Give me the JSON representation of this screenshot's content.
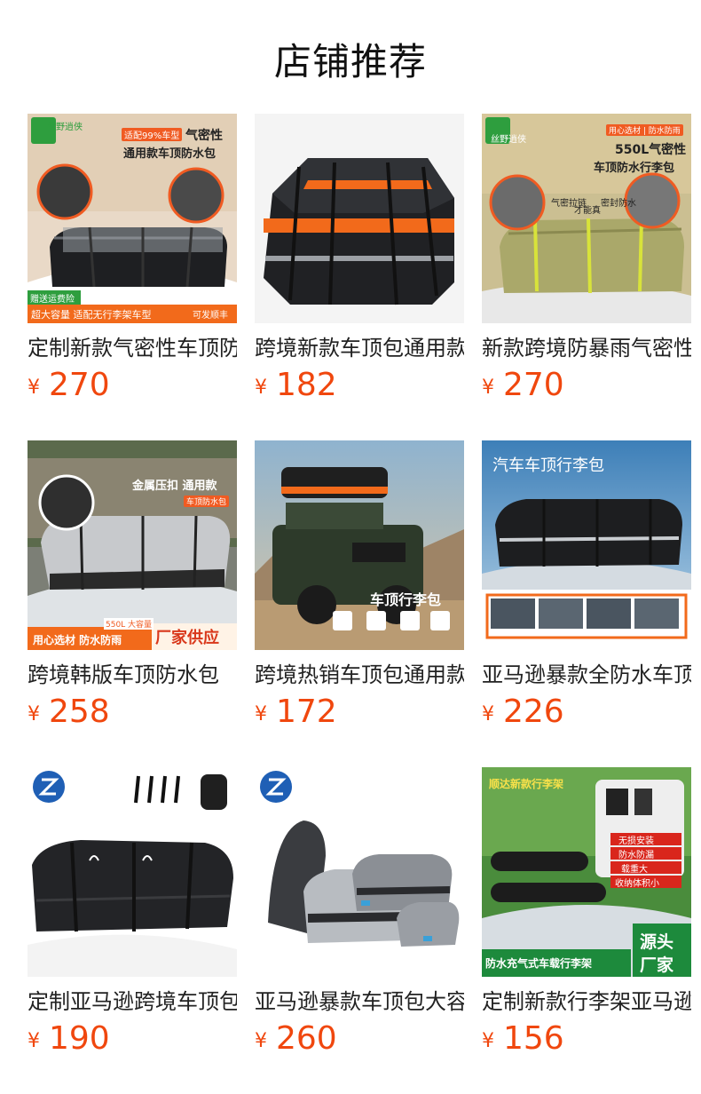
{
  "section_title": "店铺推荐",
  "products": [
    {
      "name": "定制新款气密性车顶防水包",
      "currency": "¥",
      "price": "270",
      "image_text": {
        "logo": "丝野逍侠",
        "tag": "适配99%车型",
        "headline_1": "气密性",
        "headline_2": "通用款车顶防水包",
        "bottom_1": "赠送运费险",
        "bottom_2": "超大容量 适配无行李架车型",
        "bottom_3": "可发顺丰"
      }
    },
    {
      "name": "跨境新款车顶包通用款",
      "currency": "¥",
      "price": "182",
      "image_text": {}
    },
    {
      "name": "新款跨境防暴雨气密性",
      "currency": "¥",
      "price": "270",
      "image_text": {
        "logo": "丝野逍侠",
        "tag": "用心选材 | 防水防雨",
        "headline_1": "550L气密性",
        "headline_2": "车顶防水行李包",
        "feature_1": "气密拉链",
        "feature_2": "才能真",
        "feature_3": "密封防水"
      }
    },
    {
      "name": "跨境韩版车顶防水包",
      "currency": "¥",
      "price": "258",
      "image_text": {
        "headline_1": "金属压扣 通用款",
        "tag": "车顶防水包",
        "capacity": "550L 大容量",
        "bottom_1": "用心选材 防水防雨",
        "bottom_2": "厂家供应"
      }
    },
    {
      "name": "跨境热销车顶包通用款",
      "currency": "¥",
      "price": "172",
      "image_text": {
        "headline_1": "车顶行李包"
      }
    },
    {
      "name": "亚马逊暴款全防水车顶包",
      "currency": "¥",
      "price": "226",
      "image_text": {
        "headline_1": "汽车车顶行李包"
      }
    },
    {
      "name": "定制亚马逊跨境车顶包",
      "currency": "¥",
      "price": "190",
      "image_text": {}
    },
    {
      "name": "亚马逊暴款车顶包大容量",
      "currency": "¥",
      "price": "260",
      "image_text": {}
    },
    {
      "name": "定制新款行李架亚马逊",
      "currency": "¥",
      "price": "156",
      "image_text": {
        "headline_1": "顺达新款行李架",
        "badge_1": "无损安装",
        "badge_2": "防水防漏",
        "badge_3": "载重大",
        "badge_4": "收纳体积小",
        "bottom_1": "防水充气式车载行李架",
        "bottom_2": "源头",
        "bottom_3": "厂家"
      }
    }
  ],
  "colors": {
    "price": "#f0470e",
    "orange": "#f26a1b",
    "green": "#2e9e3e",
    "olive": "#b7b46a"
  }
}
